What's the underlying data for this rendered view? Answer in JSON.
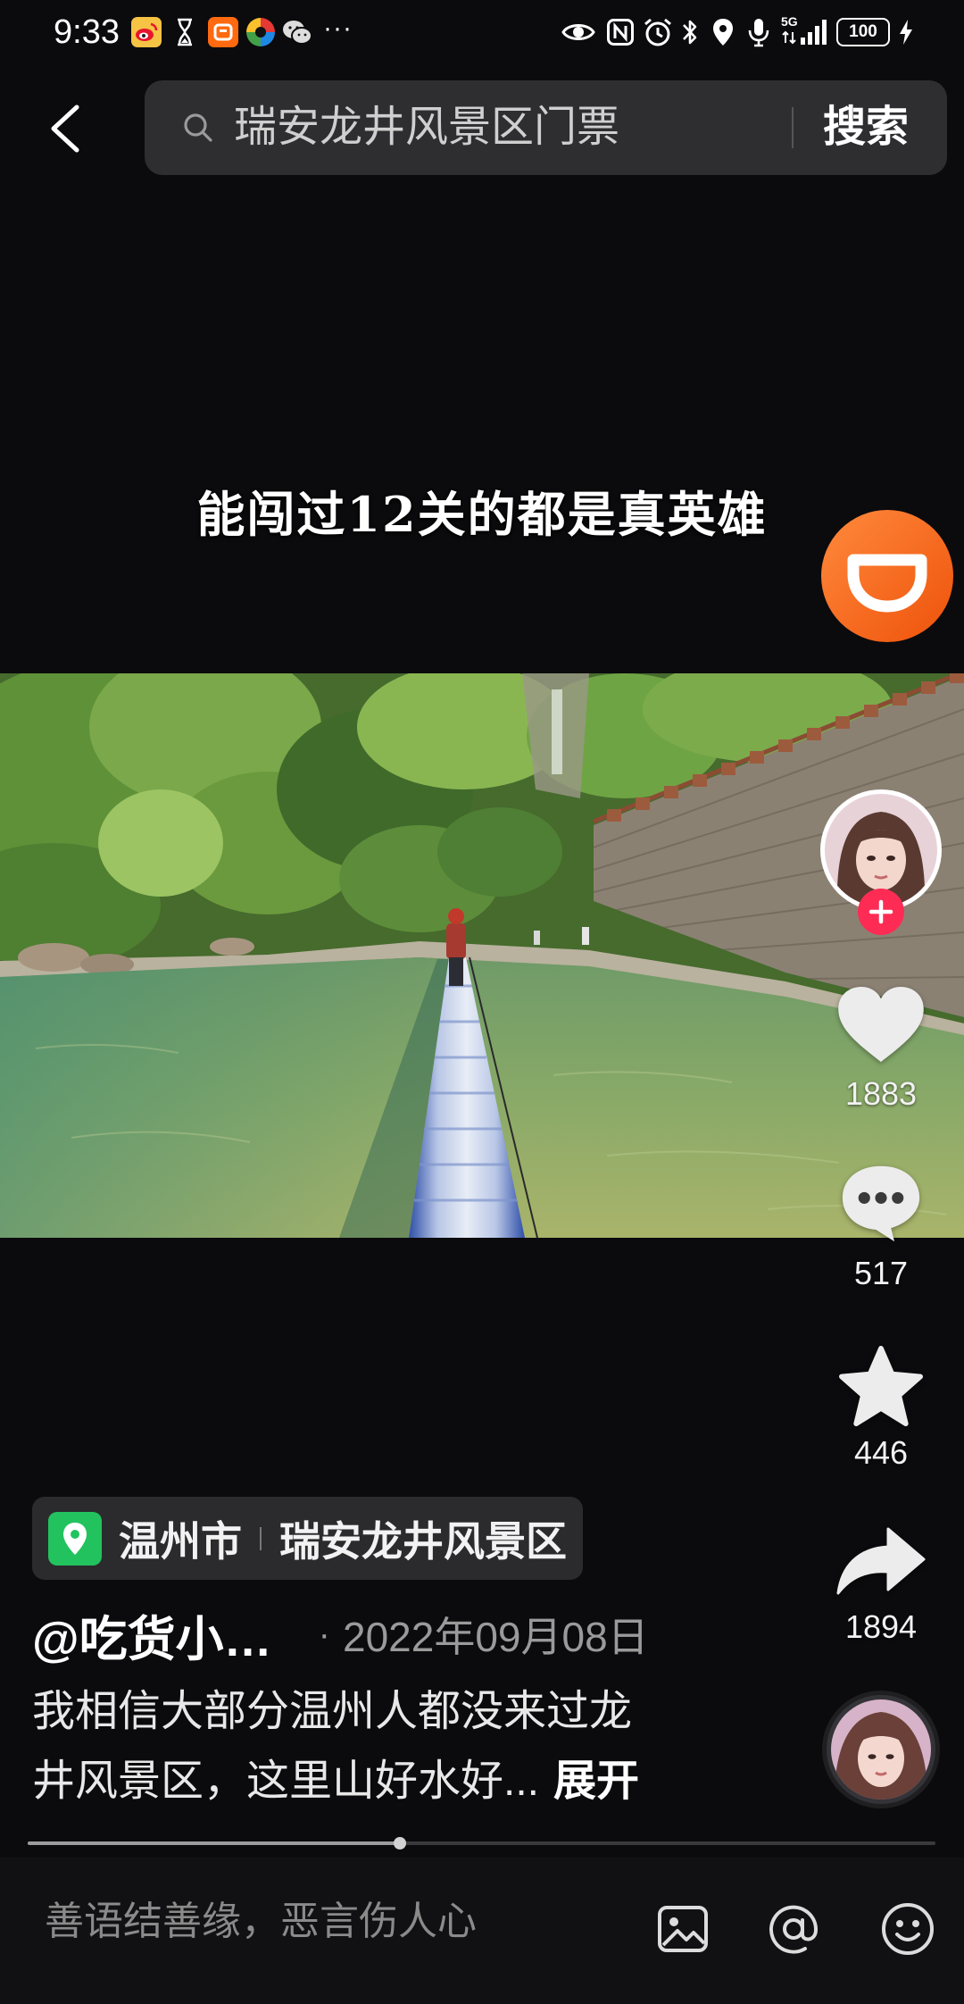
{
  "status_bar": {
    "time": "9:33",
    "left_icons": [
      "weibo-icon",
      "hourglass-icon",
      "taobao-icon",
      "colorful-app-icon",
      "wechat-icon"
    ],
    "more": "···",
    "right_icons": [
      "eye-icon",
      "nfc-icon",
      "alarm-icon",
      "bluetooth-icon",
      "location-icon",
      "mic-icon",
      "signal-icon",
      "battery-icon",
      "charging-icon"
    ],
    "network": "5G",
    "battery": "100"
  },
  "header": {
    "back_icon": "chevron-left-icon",
    "search": {
      "icon": "search-icon",
      "value": "瑞安龙井风景区门票",
      "button": "搜索"
    }
  },
  "video": {
    "caption": "能闯过12关的都是真英雄",
    "progress": 0.41
  },
  "floating_badge": {
    "icon": "didi-icon"
  },
  "actions": {
    "follow_icon": "plus-icon",
    "like": {
      "icon": "heart-icon",
      "count": "1883"
    },
    "comment": {
      "icon": "comment-icon",
      "count": "517"
    },
    "favorite": {
      "icon": "star-icon",
      "count": "446"
    },
    "share": {
      "icon": "share-icon",
      "count": "1894"
    },
    "music_icon": "music-disc-icon"
  },
  "location": {
    "icon": "location-pin-icon",
    "city": "温州市",
    "poi": "瑞安龙井风景区"
  },
  "post": {
    "author": "@吃货小…",
    "separator": "·",
    "date": "2022年09月08日",
    "description_lines": [
      "我相信大部分温州人都没来过龙",
      "井风景区，这里山好水好..."
    ],
    "expand": "展开"
  },
  "comment_bar": {
    "placeholder": "善语结善缘，恶言伤人心",
    "icons": [
      "image-icon",
      "at-icon",
      "emoji-icon"
    ]
  },
  "colors": {
    "background": "#0b0b0d",
    "follow_red": "#fe2c55",
    "didi_orange": "#f6651a",
    "location_green": "#22c35e",
    "icon_white": "#ececec"
  }
}
